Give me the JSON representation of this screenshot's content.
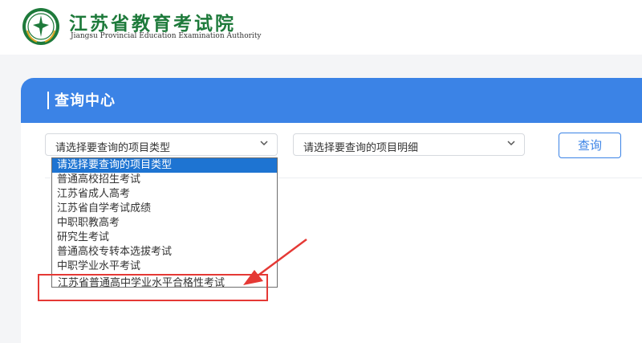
{
  "header": {
    "org_name_cn": "江苏省教育考试院",
    "org_name_en": "Jiangsu Provincial Education Examination Authority"
  },
  "panel": {
    "title": "查询中心"
  },
  "form": {
    "type_select_value": "请选择要查询的项目类型",
    "detail_select_value": "请选择要查询的项目明细",
    "query_button": "查询"
  },
  "dropdown": {
    "options": [
      "请选择要查询的项目类型",
      "普通高校招生考试",
      "江苏省成人高考",
      "江苏省自学考试成绩",
      "中职职教高考",
      "研究生考试",
      "普通高校专转本选拔考试",
      "中职学业水平考试",
      "江苏省普通高中学业水平合格性考试"
    ],
    "selected_index": 0,
    "highlighted_option": "江苏省普通高中学业水平合格性考试"
  },
  "colors": {
    "brand_green": "#1e7a3b",
    "panel_blue": "#3b83e6",
    "selected_option_blue": "#1e74d2",
    "annotation_red": "#e53935"
  },
  "icons": {
    "logo": "seal-logo-icon",
    "select_chevron": "chevron-down-icon",
    "annotation": "red-arrow-icon"
  }
}
